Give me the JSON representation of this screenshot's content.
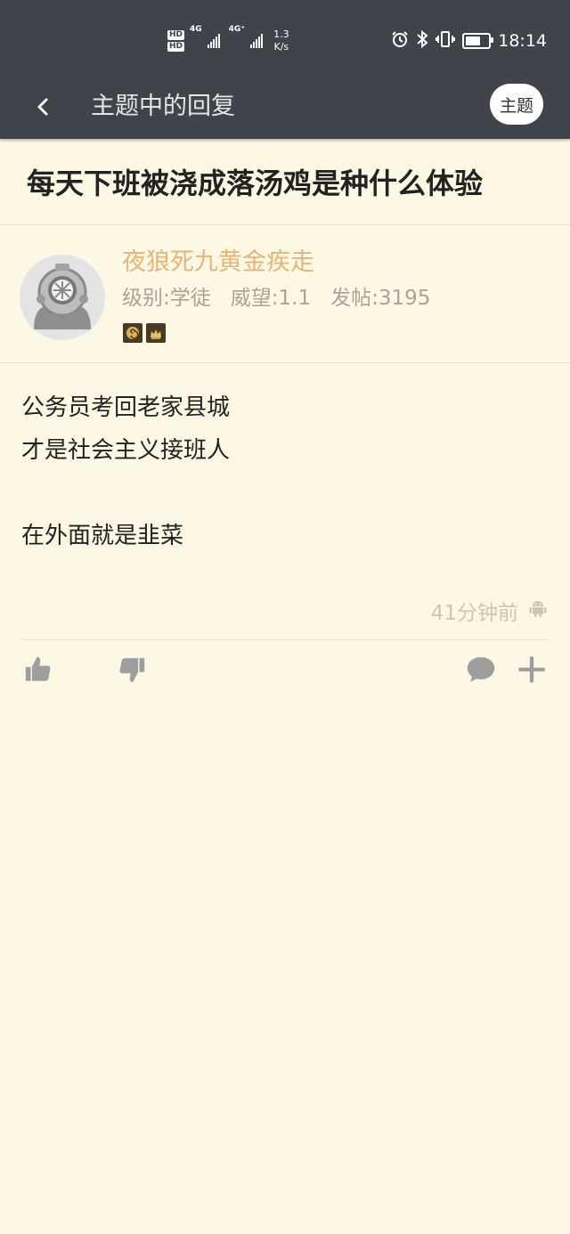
{
  "status_bar": {
    "network_speed_value": "1.3",
    "network_speed_unit": "K/s",
    "time": "18:14",
    "sim1_label": "HD",
    "sim2_label": "HD",
    "sig1_label": "4G",
    "sig2_label": "4G⁺"
  },
  "header": {
    "title": "主题中的回复",
    "topic_button": "主题"
  },
  "post": {
    "title": "每天下班被浇成落汤鸡是种什么体验"
  },
  "author": {
    "name": "夜狼死九黄金疾走",
    "level": "级别:学徒",
    "prestige": "威望:1.1",
    "posts": "发帖:3195"
  },
  "reply": {
    "lines": [
      "公务员考回老家县城",
      "才是社会主义接班人",
      "",
      "在外面就是韭菜"
    ],
    "time": "41分钟前"
  },
  "colors": {
    "bar_bg": "#3e4449",
    "page_bg": "#fdf8e4",
    "username": "#e6b57a",
    "meta": "#a9a39a",
    "icon": "#9e9e9e"
  }
}
